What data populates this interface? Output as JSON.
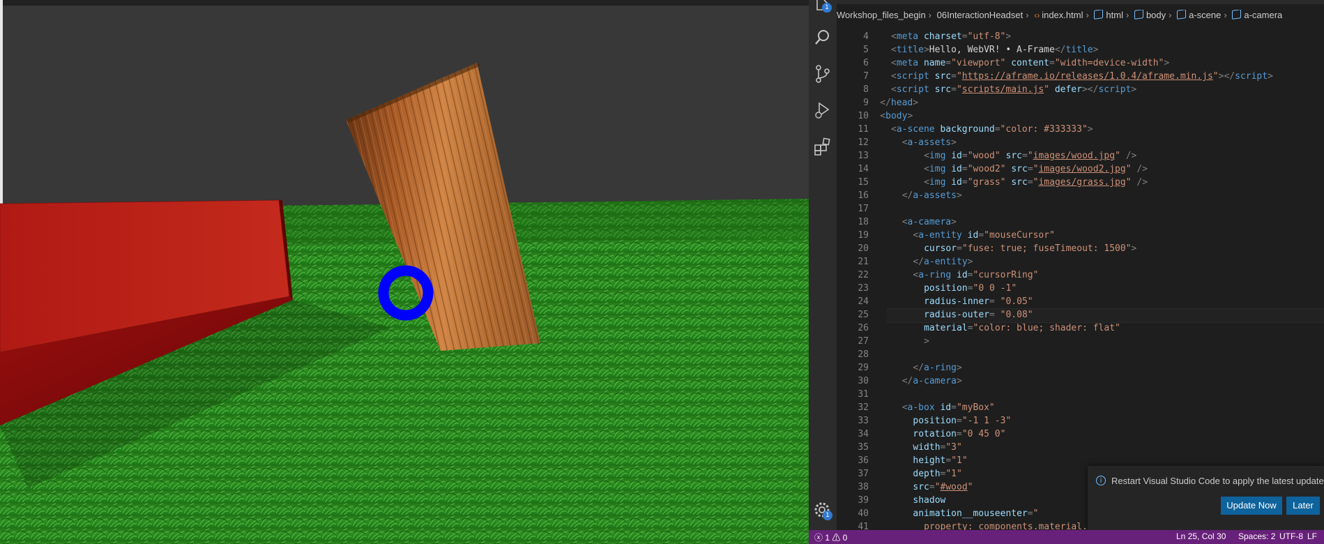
{
  "preview": {
    "background_color": "#333333",
    "cursor_ring_color": "blue"
  },
  "activity_bar": {
    "icons": [
      "files-icon",
      "search-icon",
      "source-control-icon",
      "run-debug-icon",
      "extensions-icon",
      "settings-gear-icon"
    ],
    "explorer_badge": "1",
    "settings_badge": "1"
  },
  "breadcrumb": {
    "items": [
      "Workshop_files_begin",
      "06InteractionHeadset",
      "index.html",
      "html",
      "body",
      "a-scene",
      "a-camera"
    ]
  },
  "editor": {
    "lines": [
      {
        "n": "4",
        "indent": 2,
        "tokens": [
          [
            "t",
            "<"
          ],
          [
            "tn",
            "meta"
          ],
          [
            "an",
            " charset"
          ],
          [
            "t",
            "="
          ],
          [
            "av",
            "\"utf-8\""
          ],
          [
            "t",
            ">"
          ]
        ]
      },
      {
        "n": "5",
        "indent": 2,
        "tokens": [
          [
            "t",
            "<"
          ],
          [
            "tn",
            "title"
          ],
          [
            "t",
            ">"
          ],
          [
            "tx",
            "Hello, WebVR! • A-Frame"
          ],
          [
            "t",
            "</"
          ],
          [
            "tn",
            "title"
          ],
          [
            "t",
            ">"
          ]
        ]
      },
      {
        "n": "6",
        "indent": 2,
        "tokens": [
          [
            "t",
            "<"
          ],
          [
            "tn",
            "meta"
          ],
          [
            "an",
            " name"
          ],
          [
            "t",
            "="
          ],
          [
            "av",
            "\"viewport\""
          ],
          [
            "an",
            " content"
          ],
          [
            "t",
            "="
          ],
          [
            "av",
            "\"width=device-width\""
          ],
          [
            "t",
            ">"
          ]
        ]
      },
      {
        "n": "7",
        "indent": 2,
        "tokens": [
          [
            "t",
            "<"
          ],
          [
            "tn",
            "script"
          ],
          [
            "an",
            " src"
          ],
          [
            "t",
            "="
          ],
          [
            "av",
            "\""
          ],
          [
            "avu",
            "https://aframe.io/releases/1.0.4/aframe.min.js"
          ],
          [
            "av",
            "\""
          ],
          [
            "t",
            "></"
          ],
          [
            "tn",
            "script"
          ],
          [
            "t",
            ">"
          ]
        ]
      },
      {
        "n": "8",
        "indent": 2,
        "tokens": [
          [
            "t",
            "<"
          ],
          [
            "tn",
            "script"
          ],
          [
            "an",
            " src"
          ],
          [
            "t",
            "="
          ],
          [
            "av",
            "\""
          ],
          [
            "avu",
            "scripts/main.js"
          ],
          [
            "av",
            "\""
          ],
          [
            "an",
            " defer"
          ],
          [
            "t",
            "></"
          ],
          [
            "tn",
            "script"
          ],
          [
            "t",
            ">"
          ]
        ]
      },
      {
        "n": "9",
        "indent": 1,
        "tokens": [
          [
            "t",
            "</"
          ],
          [
            "tn",
            "head"
          ],
          [
            "t",
            ">"
          ]
        ]
      },
      {
        "n": "10",
        "indent": 1,
        "tokens": [
          [
            "t",
            "<"
          ],
          [
            "tn",
            "body"
          ],
          [
            "t",
            ">"
          ]
        ]
      },
      {
        "n": "11",
        "indent": 2,
        "tokens": [
          [
            "t",
            "<"
          ],
          [
            "tn",
            "a-scene"
          ],
          [
            "an",
            " background"
          ],
          [
            "t",
            "="
          ],
          [
            "av",
            "\"color: #333333\""
          ],
          [
            "t",
            ">"
          ]
        ]
      },
      {
        "n": "12",
        "indent": 3,
        "tokens": [
          [
            "t",
            "<"
          ],
          [
            "tn",
            "a-assets"
          ],
          [
            "t",
            ">"
          ]
        ]
      },
      {
        "n": "13",
        "indent": 5,
        "tokens": [
          [
            "t",
            "<"
          ],
          [
            "tn",
            "img"
          ],
          [
            "an",
            " id"
          ],
          [
            "t",
            "="
          ],
          [
            "av",
            "\"wood\""
          ],
          [
            "an",
            " src"
          ],
          [
            "t",
            "="
          ],
          [
            "av",
            "\""
          ],
          [
            "avu",
            "images/wood.jpg"
          ],
          [
            "av",
            "\""
          ],
          [
            "t",
            " />"
          ]
        ]
      },
      {
        "n": "14",
        "indent": 5,
        "tokens": [
          [
            "t",
            "<"
          ],
          [
            "tn",
            "img"
          ],
          [
            "an",
            " id"
          ],
          [
            "t",
            "="
          ],
          [
            "av",
            "\"wood2\""
          ],
          [
            "an",
            " src"
          ],
          [
            "t",
            "="
          ],
          [
            "av",
            "\""
          ],
          [
            "avu",
            "images/wood2.jpg"
          ],
          [
            "av",
            "\""
          ],
          [
            "t",
            " />"
          ]
        ]
      },
      {
        "n": "15",
        "indent": 5,
        "tokens": [
          [
            "t",
            "<"
          ],
          [
            "tn",
            "img"
          ],
          [
            "an",
            " id"
          ],
          [
            "t",
            "="
          ],
          [
            "av",
            "\"grass\""
          ],
          [
            "an",
            " src"
          ],
          [
            "t",
            "="
          ],
          [
            "av",
            "\""
          ],
          [
            "avu",
            "images/grass.jpg"
          ],
          [
            "av",
            "\""
          ],
          [
            "t",
            " />"
          ]
        ]
      },
      {
        "n": "16",
        "indent": 3,
        "tokens": [
          [
            "t",
            "</"
          ],
          [
            "tn",
            "a-assets"
          ],
          [
            "t",
            ">"
          ]
        ]
      },
      {
        "n": "17",
        "indent": 0,
        "tokens": []
      },
      {
        "n": "18",
        "indent": 3,
        "tokens": [
          [
            "t",
            "<"
          ],
          [
            "tn",
            "a-camera"
          ],
          [
            "t",
            ">"
          ]
        ]
      },
      {
        "n": "19",
        "indent": 4,
        "tokens": [
          [
            "t",
            "<"
          ],
          [
            "tn",
            "a-entity"
          ],
          [
            "an",
            " id"
          ],
          [
            "t",
            "="
          ],
          [
            "av",
            "\"mouseCursor\""
          ]
        ]
      },
      {
        "n": "20",
        "indent": 5,
        "tokens": [
          [
            "an",
            "cursor"
          ],
          [
            "t",
            "="
          ],
          [
            "av",
            "\"fuse: true; fuseTimeout: 1500\""
          ],
          [
            "t",
            ">"
          ]
        ]
      },
      {
        "n": "21",
        "indent": 4,
        "tokens": [
          [
            "t",
            "</"
          ],
          [
            "tn",
            "a-entity"
          ],
          [
            "t",
            ">"
          ]
        ]
      },
      {
        "n": "22",
        "indent": 4,
        "tokens": [
          [
            "t",
            "<"
          ],
          [
            "tn",
            "a-ring"
          ],
          [
            "an",
            " id"
          ],
          [
            "t",
            "="
          ],
          [
            "av",
            "\"cursorRing\""
          ]
        ]
      },
      {
        "n": "23",
        "indent": 5,
        "tokens": [
          [
            "an",
            "position"
          ],
          [
            "t",
            "="
          ],
          [
            "av",
            "\"0 0 -1\""
          ]
        ]
      },
      {
        "n": "24",
        "indent": 5,
        "tokens": [
          [
            "an",
            "radius-inner"
          ],
          [
            "t",
            "= "
          ],
          [
            "av",
            "\"0.05\""
          ]
        ]
      },
      {
        "n": "25",
        "indent": 5,
        "tokens": [
          [
            "an",
            "radius-outer"
          ],
          [
            "t",
            "= "
          ],
          [
            "av",
            "\"0.08\""
          ]
        ]
      },
      {
        "n": "26",
        "indent": 5,
        "tokens": [
          [
            "an",
            "material"
          ],
          [
            "t",
            "="
          ],
          [
            "av",
            "\"color: blue; shader: flat\""
          ]
        ]
      },
      {
        "n": "27",
        "indent": 5,
        "tokens": [
          [
            "t",
            ">"
          ]
        ]
      },
      {
        "n": "28",
        "indent": 0,
        "tokens": []
      },
      {
        "n": "29",
        "indent": 4,
        "tokens": [
          [
            "t",
            "</"
          ],
          [
            "tn",
            "a-ring"
          ],
          [
            "t",
            ">"
          ]
        ]
      },
      {
        "n": "30",
        "indent": 3,
        "tokens": [
          [
            "t",
            "</"
          ],
          [
            "tn",
            "a-camera"
          ],
          [
            "t",
            ">"
          ]
        ]
      },
      {
        "n": "31",
        "indent": 0,
        "tokens": []
      },
      {
        "n": "32",
        "indent": 3,
        "tokens": [
          [
            "t",
            "<"
          ],
          [
            "tn",
            "a-box"
          ],
          [
            "an",
            " id"
          ],
          [
            "t",
            "="
          ],
          [
            "av",
            "\"myBox\""
          ]
        ]
      },
      {
        "n": "33",
        "indent": 4,
        "tokens": [
          [
            "an",
            "position"
          ],
          [
            "t",
            "="
          ],
          [
            "av",
            "\"-1 1 -3\""
          ]
        ]
      },
      {
        "n": "34",
        "indent": 4,
        "tokens": [
          [
            "an",
            "rotation"
          ],
          [
            "t",
            "="
          ],
          [
            "av",
            "\"0 45 0\""
          ]
        ]
      },
      {
        "n": "35",
        "indent": 4,
        "tokens": [
          [
            "an",
            "width"
          ],
          [
            "t",
            "="
          ],
          [
            "av",
            "\"3\""
          ]
        ]
      },
      {
        "n": "36",
        "indent": 4,
        "tokens": [
          [
            "an",
            "height"
          ],
          [
            "t",
            "="
          ],
          [
            "av",
            "\"1\""
          ]
        ]
      },
      {
        "n": "37",
        "indent": 4,
        "tokens": [
          [
            "an",
            "depth"
          ],
          [
            "t",
            "="
          ],
          [
            "av",
            "\"1\""
          ]
        ]
      },
      {
        "n": "38",
        "indent": 4,
        "tokens": [
          [
            "an",
            "src"
          ],
          [
            "t",
            "="
          ],
          [
            "av",
            "\""
          ],
          [
            "avu",
            "#wood"
          ],
          [
            "av",
            "\""
          ]
        ]
      },
      {
        "n": "39",
        "indent": 4,
        "tokens": [
          [
            "an",
            "shadow"
          ]
        ]
      },
      {
        "n": "40",
        "indent": 4,
        "tokens": [
          [
            "an",
            "animation__mouseenter"
          ],
          [
            "t",
            "="
          ],
          [
            "av",
            "\""
          ]
        ]
      },
      {
        "n": "41",
        "indent": 5,
        "tokens": [
          [
            "av",
            "property: components.material.material.color;"
          ]
        ]
      }
    ]
  },
  "notification": {
    "message": "Restart Visual Studio Code to apply the latest update.",
    "primary_button": "Update Now",
    "secondary_button": "Later"
  },
  "status_bar": {
    "problems": "ⓧ 1 ⚠ 0",
    "cursor_position": "Ln 25, Col 30",
    "indentation": "Spaces: 2",
    "encoding": "UTF-8",
    "eol": "LF"
  }
}
